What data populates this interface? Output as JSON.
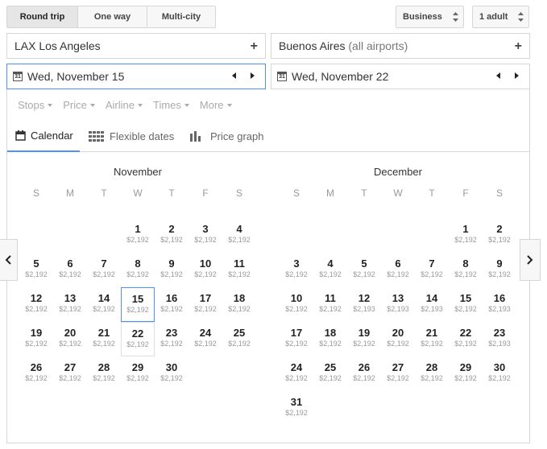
{
  "trip_types": [
    {
      "label": "Round trip",
      "active": true,
      "w": 88
    },
    {
      "label": "One way",
      "active": false,
      "w": 86
    },
    {
      "label": "Multi-city",
      "active": false,
      "w": 84
    }
  ],
  "cabin": {
    "label": "Business"
  },
  "passengers": {
    "label": "1 adult"
  },
  "origin": {
    "code": "LAX",
    "city": "Los Angeles"
  },
  "destination": {
    "city": "Buenos Aires",
    "detail": "(all airports)"
  },
  "depart_date": "Wed, November 15",
  "return_date": "Wed, November 22",
  "calendar_icon_text": "31",
  "filters": [
    "Stops",
    "Price",
    "Airline",
    "Times",
    "More"
  ],
  "tabs": [
    "Calendar",
    "Flexible dates",
    "Price graph"
  ],
  "weekdays": [
    "S",
    "M",
    "T",
    "W",
    "T",
    "F",
    "S"
  ],
  "months": [
    {
      "name": "November",
      "start": 3,
      "days": 30,
      "prices": [
        "$2,192",
        "$2,192",
        "$2,192",
        "$2,192",
        "$2,192",
        "$2,192",
        "$2,192",
        "$2,192",
        "$2,192",
        "$2,192",
        "$2,192",
        "$2,192",
        "$2,192",
        "$2,192",
        "$2,192",
        "$2,192",
        "$2,192",
        "$2,192",
        "$2,192",
        "$2,192",
        "$2,192",
        "$2,192",
        "$2,192",
        "$2,192",
        "$2,192",
        "$2,192",
        "$2,192",
        "$2,192",
        "$2,192",
        "$2,192"
      ]
    },
    {
      "name": "December",
      "start": 5,
      "days": 31,
      "prices": [
        "$2,192",
        "$2,192",
        "$2,192",
        "$2,192",
        "$2,192",
        "$2,192",
        "$2,192",
        "$2,192",
        "$2,192",
        "$2,192",
        "$2,192",
        "$2,193",
        "$2,193",
        "$2,193",
        "$2,192",
        "$2,193",
        "$2,192",
        "$2,192",
        "$2,192",
        "$2,192",
        "$2,192",
        "$2,192",
        "$2,193",
        "$2,192",
        "$2,192",
        "$2,192",
        "$2,192",
        "$2,192",
        "$2,192",
        "$2,192",
        "$2,192"
      ]
    }
  ],
  "selected": {
    "depart_day": 15,
    "return_day": 22
  },
  "colors": {
    "accent": "#4d90fe",
    "price": "#999999",
    "border": "#d6d6d6"
  }
}
